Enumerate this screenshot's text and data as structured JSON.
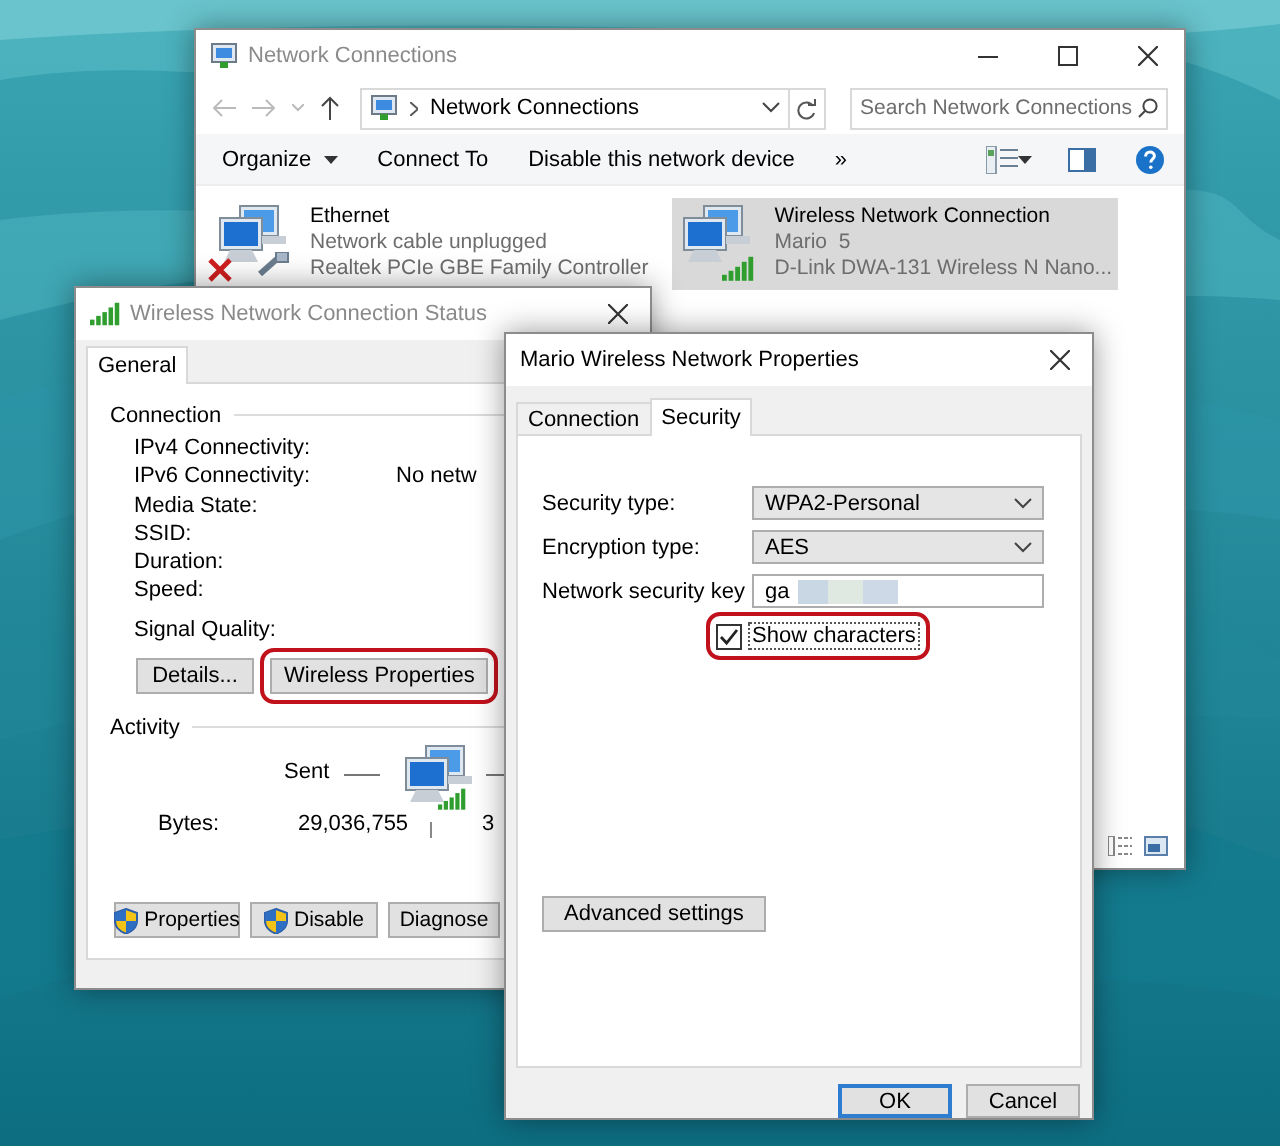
{
  "network_connections": {
    "title": "Network Connections",
    "breadcrumb": "Network Connections",
    "search": {
      "placeholder": "Search Network Connections"
    },
    "toolbar": [
      {
        "label": "Organize",
        "dropdown": true
      },
      {
        "label": "Connect To",
        "dropdown": false
      },
      {
        "label": "Disable this network device",
        "dropdown": false
      },
      {
        "label": "»",
        "dropdown": false
      }
    ],
    "connections": [
      {
        "name": "Ethernet",
        "status": "Network cable unplugged",
        "device": "Realtek PCIe GBE Family Controller",
        "kind": "wired",
        "selected": false
      },
      {
        "name": "Wireless Network Connection",
        "status": "Mario  5",
        "device": "D-Link DWA-131 Wireless N Nano...",
        "kind": "wireless",
        "selected": true
      }
    ]
  },
  "status_window": {
    "title": "Wireless Network Connection Status",
    "tabs": [
      {
        "label": "General",
        "selected": true
      }
    ],
    "connection": {
      "heading": "Connection",
      "rows": [
        {
          "label": "IPv4 Connectivity:"
        },
        {
          "label": "IPv6 Connectivity:",
          "value": "No netw"
        },
        {
          "label": "Media State:"
        },
        {
          "label": "SSID:"
        },
        {
          "label": "Duration:"
        },
        {
          "label": "Speed:"
        }
      ],
      "signal_label": "Signal Quality:"
    },
    "buttons": [
      {
        "label": "Details...",
        "highlighted": false
      },
      {
        "label": "Wireless Properties",
        "highlighted": true
      }
    ],
    "activity": {
      "heading": "Activity",
      "sent_label": "Sent",
      "bytes_label": "Bytes:",
      "bytes_sent": "29,036,755",
      "bytes_received": "3"
    },
    "bottom_buttons": [
      {
        "label": "Properties",
        "shield": true
      },
      {
        "label": "Disable",
        "shield": true
      },
      {
        "label": "Diagnose",
        "shield": false
      }
    ]
  },
  "properties_window": {
    "title": "Mario Wireless Network Properties",
    "tabs": [
      {
        "label": "Connection",
        "selected": false
      },
      {
        "label": "Security",
        "selected": true
      }
    ],
    "fields": [
      {
        "label": "Security type:",
        "kind": "select",
        "value": "WPA2-Personal"
      },
      {
        "label": "Encryption type:",
        "kind": "select",
        "value": "AES"
      },
      {
        "label": "Network security key",
        "kind": "text",
        "value": "ga",
        "blurred": true
      }
    ],
    "checkbox": {
      "label": "Show characters",
      "checked": true,
      "highlighted": true
    },
    "advanced_button": "Advanced settings",
    "buttons": [
      {
        "label": "OK",
        "default": true
      },
      {
        "label": "Cancel",
        "default": false
      }
    ]
  }
}
